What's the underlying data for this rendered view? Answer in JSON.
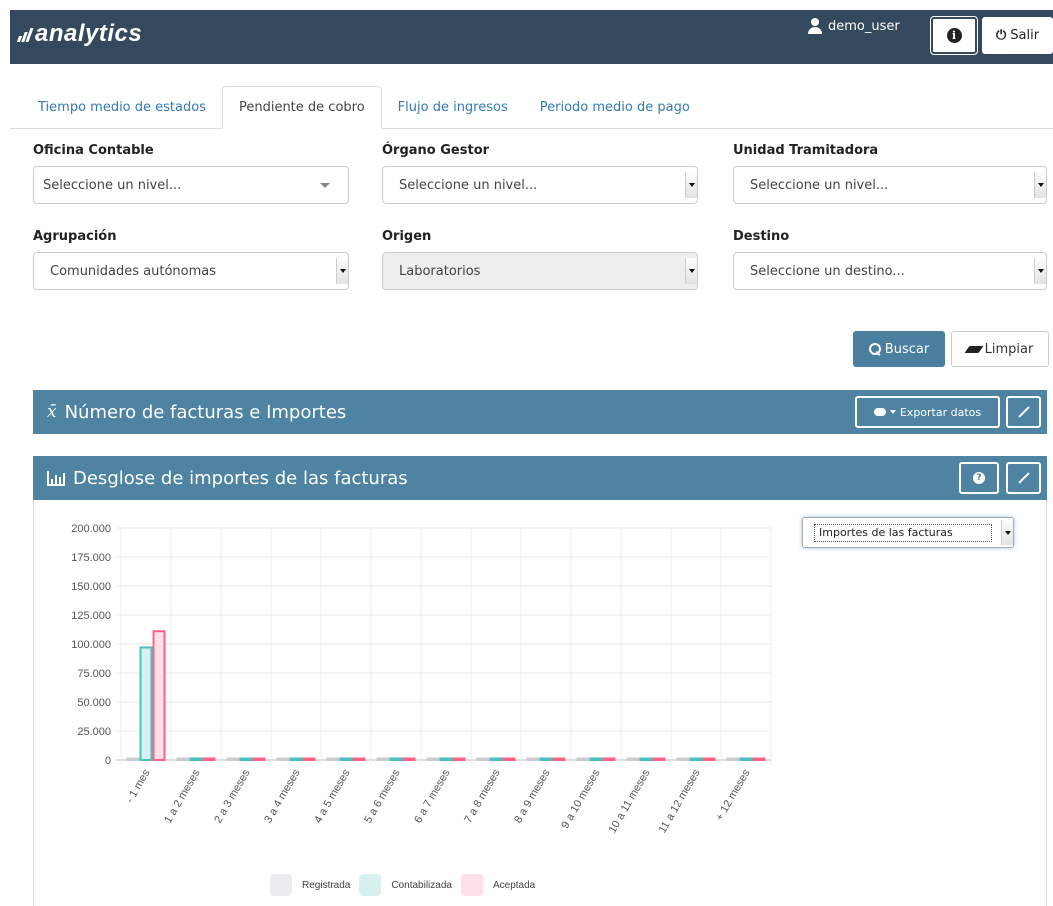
{
  "header": {
    "logo_text": "analytics",
    "username": "demo_user",
    "logout_label": "Salir"
  },
  "tabs": [
    {
      "label": "Tiempo medio de estados",
      "active": false
    },
    {
      "label": "Pendiente de cobro",
      "active": true
    },
    {
      "label": "Flujo de ingresos",
      "active": false
    },
    {
      "label": "Periodo medio de pago",
      "active": false
    }
  ],
  "filters": {
    "oficina": {
      "label": "Oficina Contable",
      "value": "Seleccione un nivel..."
    },
    "organo": {
      "label": "Órgano Gestor",
      "value": "Seleccione un nivel..."
    },
    "unidad": {
      "label": "Unidad Tramitadora",
      "value": "Seleccione un nivel..."
    },
    "agrupacion": {
      "label": "Agrupación",
      "value": "Comunidades autónomas"
    },
    "origen": {
      "label": "Origen",
      "value": "Laboratorios"
    },
    "destino": {
      "label": "Destino",
      "value": "Seleccione un destino..."
    }
  },
  "actions": {
    "search_label": "Buscar",
    "clear_label": "Limpiar"
  },
  "panel1": {
    "title": "Número de facturas e Importes",
    "export_label": "Exportar datos"
  },
  "panel2": {
    "title": "Desglose de importes de las facturas",
    "chart_select_value": "Importes de las facturas"
  },
  "colors": {
    "topbar": "#34495e",
    "panel_header": "#4e83a1",
    "primary_button": "#4a7fa0",
    "link": "#337ab7"
  },
  "chart_data": {
    "type": "bar",
    "categories": [
      "- 1 mes",
      "1 a 2 meses",
      "2 a 3 meses",
      "3 a 4 meses",
      "4 a 5 meses",
      "5 a 6 meses",
      "6 a 7 meses",
      "7 a 8 meses",
      "8 a 9 meses",
      "9 a 10 meses",
      "10 a 11 meses",
      "11 a 12 meses",
      "+ 12 meses"
    ],
    "series": [
      {
        "name": "Registrada",
        "fill": "#ebebf0",
        "stroke": "#c9cbcf",
        "values": [
          0,
          0,
          0,
          0,
          0,
          0,
          0,
          0,
          0,
          0,
          0,
          0,
          0
        ]
      },
      {
        "name": "Contabilizada",
        "fill": "#d7f1f1",
        "stroke": "#4bc0c0",
        "values": [
          97000,
          0,
          0,
          0,
          0,
          0,
          0,
          0,
          0,
          0,
          0,
          0,
          0
        ]
      },
      {
        "name": "Aceptada",
        "fill": "#ffe0e6",
        "stroke": "#ff6384",
        "values": [
          111000,
          0,
          0,
          0,
          0,
          0,
          0,
          0,
          0,
          0,
          0,
          0,
          0
        ]
      }
    ],
    "y_ticks": [
      "200.000",
      "175.000",
      "150.000",
      "125.000",
      "100.000",
      "75.000",
      "50.000",
      "25.000",
      "0"
    ],
    "ylim": [
      0,
      200000
    ],
    "grid": true,
    "legend_position": "bottom"
  }
}
